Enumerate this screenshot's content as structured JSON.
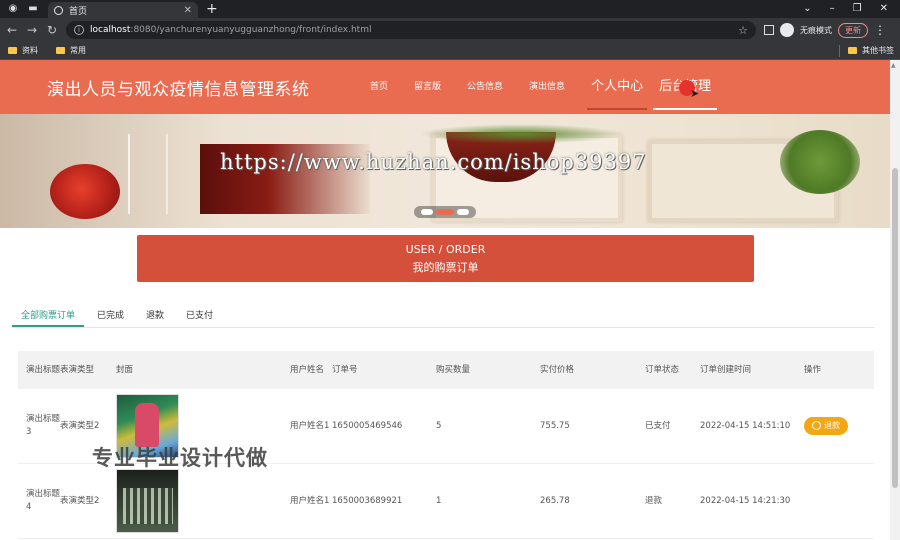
{
  "browser": {
    "tab_title": "首页",
    "new_tab": "+",
    "url_host": "localhost",
    "url_path": ":8080/yanchurenyuanyugguanzhong/front/index.html",
    "incognito_label": "无痕模式",
    "update_label": "更新",
    "bookmarks": [
      "资料",
      "常用"
    ],
    "other_bookmarks": "其他书签"
  },
  "site": {
    "title": "演出人员与观众疫情信息管理系统",
    "nav": [
      {
        "label": "首页"
      },
      {
        "label": "留言版"
      },
      {
        "label": "公告信息"
      },
      {
        "label": "演出信息"
      },
      {
        "label": "个人中心"
      },
      {
        "label": "后台管理"
      }
    ]
  },
  "banner": {
    "watermark": "https://www.huzhan.com/ishop39397",
    "slide_count": 3,
    "active_slide": 2
  },
  "order_header": {
    "en": "USER / ORDER",
    "cn": "我的购票订单"
  },
  "tabs": [
    "全部购票订单",
    "已完成",
    "退款",
    "已支付"
  ],
  "active_tab": 0,
  "table": {
    "headers": [
      "演出标题",
      "表演类型",
      "封面",
      "用户姓名",
      "订单号",
      "购买数量",
      "实付价格",
      "订单状态",
      "订单创建时间",
      "操作"
    ],
    "rows": [
      {
        "title": "演出标题3",
        "type": "表演类型2",
        "user": "用户姓名1",
        "order_no": "1650005469546",
        "qty": "5",
        "price": "755.75",
        "status": "已支付",
        "created": "2022-04-15 14:51:10",
        "action": "退款"
      },
      {
        "title": "演出标题4",
        "type": "表演类型2",
        "user": "用户姓名1",
        "order_no": "1650003689921",
        "qty": "1",
        "price": "265.78",
        "status": "退款",
        "created": "2022-04-15 14:21:30",
        "action": ""
      }
    ]
  },
  "overlay_text": "专业毕业设计代做",
  "colors": {
    "header": "#e96b50",
    "order_block": "#d4503a",
    "tab_active": "#2f9e8a",
    "refund_button": "#f3a712"
  }
}
